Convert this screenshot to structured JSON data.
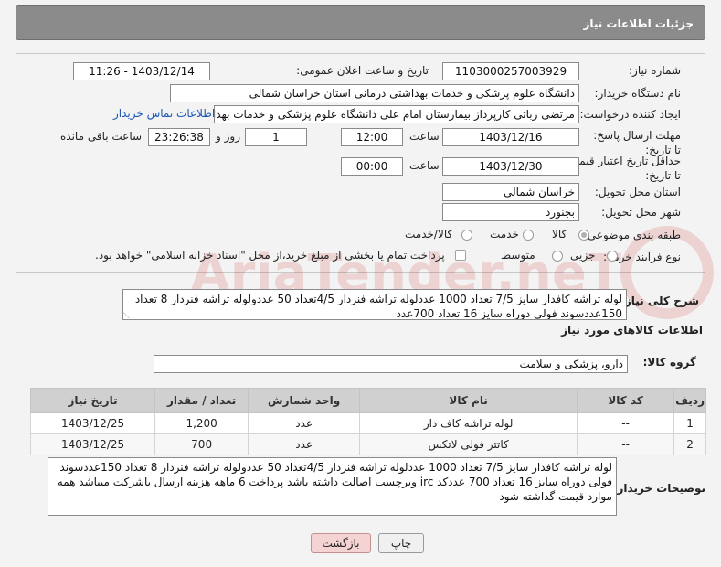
{
  "header": {
    "title": "جزئیات اطلاعات نیاز"
  },
  "form": {
    "need_number_label": "شماره نیاز:",
    "need_number": "1103000257003929",
    "announce_label": "تاریخ و ساعت اعلان عمومی:",
    "announce_value": "1403/12/14 - 11:26",
    "buyer_org_label": "نام دستگاه خریدار:",
    "buyer_org": "دانشگاه علوم پزشکی و خدمات بهداشتی درمانی استان خراسان شمالی",
    "creator_label": "ایجاد کننده درخواست:",
    "creator": "مرتضی رباتی کارپرداز بیمارستان امام علی دانشگاه علوم پزشکی و خدمات بهداشتی",
    "contact_link": "اطلاعات تماس خریدار",
    "reply_deadline_label": "مهلت ارسال پاسخ: تا تاریخ:",
    "reply_date": "1403/12/16",
    "time_label": "ساعت",
    "reply_time": "12:00",
    "days_value": "1",
    "days_label": "روز و",
    "remaining_time": "23:26:38",
    "remaining_label": "ساعت باقی مانده",
    "price_validity_label": "حداقل تاریخ اعتبار قیمت: تا تاریخ:",
    "price_date": "1403/12/30",
    "price_time": "00:00",
    "province_label": "استان محل تحویل:",
    "province": "خراسان شمالی",
    "city_label": "شهر محل تحویل:",
    "city": "بجنورد",
    "category_label": "طبقه بندی موضوعی:",
    "category_options": [
      "کالا",
      "خدمت",
      "کالا/خدمت"
    ],
    "purchase_type_label": "نوع فرآیند خرید :",
    "purchase_options": [
      "جزیی",
      "متوسط"
    ],
    "treasury_note": "پرداخت تمام یا بخشی از مبلغ خرید،از محل \"اسناد خزانه اسلامی\" خواهد بود."
  },
  "description": {
    "label": "شرح کلی نیاز:",
    "text": "لوله تراشه کافدار سایز 7/5 تعداد 1000 عددلوله تراشه فنردار 4/5تعداد 50 عددولوله تراشه فنردار 8 تعداد 150عددسوند فولی دوراه سایز 16 تعداد 700عدد"
  },
  "goods": {
    "section_title": "اطلاعات کالاهای مورد نیاز",
    "group_label": "گروه کالا:",
    "group_value": "دارو، پزشکی و سلامت",
    "columns": [
      "ردیف",
      "کد کالا",
      "نام کالا",
      "واحد شمارش",
      "تعداد / مقدار",
      "تاریخ نیاز"
    ],
    "rows": [
      [
        "1",
        "--",
        "لوله تراشه کاف دار",
        "عدد",
        "1,200",
        "1403/12/25"
      ],
      [
        "2",
        "--",
        "کاتتر فولی لاتکس",
        "عدد",
        "700",
        "1403/12/25"
      ]
    ]
  },
  "buyer_notes": {
    "label": "توضیحات خریدار:",
    "text": "لوله تراشه کافدار سایز 7/5  تعداد 1000 عددلوله تراشه فنردار 4/5تعداد 50 عددولوله تراشه فنردار 8 تعداد 150عددسوند فولی دوراه سایز 16 تعداد 700 عددکد irc وبرچسب اصالت داشته باشد پرداخت 6 ماهه هزینه ارسال باشرکت میباشد همه موارد قیمت گذاشته شود"
  },
  "buttons": {
    "print": "چاپ",
    "back": "بازگشت"
  },
  "watermark": {
    "text": "AriaTender.neT"
  }
}
